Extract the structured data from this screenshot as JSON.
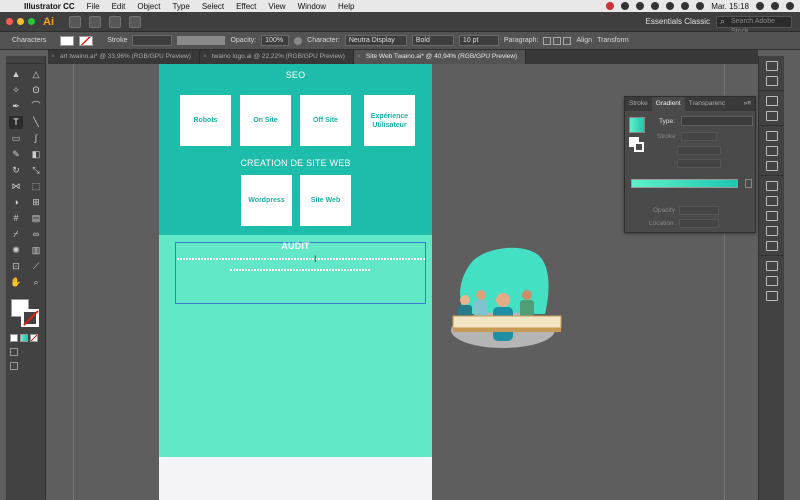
{
  "menubar": {
    "app_name": "Illustrator CC",
    "items": [
      "File",
      "Edit",
      "Object",
      "Type",
      "Select",
      "Effect",
      "View",
      "Window",
      "Help"
    ],
    "time": "Mar. 15:18"
  },
  "appbar": {
    "logo": "Ai",
    "workspace": "Essentials Classic",
    "search_placeholder": "Search Adobe Stock"
  },
  "controlbar": {
    "selection_label": "Characters",
    "stroke_label": "Stroke",
    "opacity_label": "Opacity:",
    "opacity_value": "100%",
    "character_label": "Character:",
    "font_family": "Neutra Display",
    "font_style": "Bold",
    "font_size": "10 pt",
    "paragraph_label": "Paragraph:",
    "align_label": "Align",
    "transform_label": "Transform"
  },
  "tabs": [
    "art twaino.ai* @ 33,96% (RGB/GPU Preview)",
    "twaino logo.ai @ 22,22% (RGB/GPU Preview)",
    "Site Web Twaino.ai* @ 40,94% (RGB/GPU Preview)"
  ],
  "artboard": {
    "seo_title": "SEO",
    "seo_cards": [
      "Robots",
      "On Site",
      "Off Site",
      "Expérience Utilisateur"
    ],
    "web_title": "CREATION DE SITE WEB",
    "web_cards": [
      "Wordpress",
      "Site Web"
    ],
    "audit_title": "AUDIT",
    "colors": {
      "top_band": "#1ebcaa",
      "mid_band": "#62e8c6",
      "card_text": "#17b3a4"
    }
  },
  "gradient_panel": {
    "tabs": [
      "Stroke",
      "Gradient",
      "Transparenc"
    ],
    "type_label": "Type:",
    "stroke_label": "Stroke",
    "opacity_label": "Opacity",
    "location_label": "Location"
  }
}
